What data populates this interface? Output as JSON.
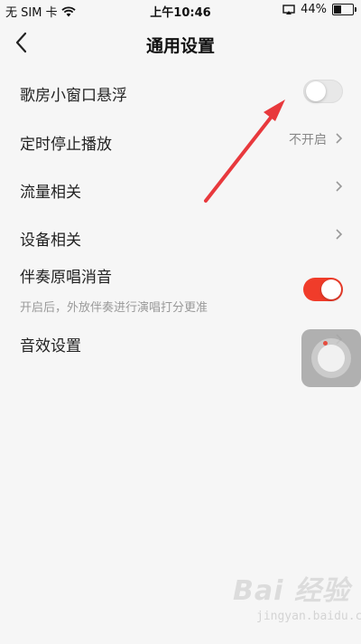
{
  "status_bar": {
    "carrier": "无 SIM 卡",
    "time": "上午10:46",
    "battery": "44%",
    "battery_level": 0.44,
    "icons": [
      "wifi-icon",
      "screen-mirror-icon",
      "battery-icon"
    ]
  },
  "nav": {
    "title": "通用设置",
    "back_icon": "chevron-left-icon"
  },
  "settings": {
    "karaoke_float": {
      "label": "歌房小窗口悬浮",
      "enabled": false
    },
    "sleep_timer": {
      "label": "定时停止播放",
      "value": "不开启"
    },
    "data_usage": {
      "label": "流量相关"
    },
    "devices": {
      "label": "设备相关"
    },
    "vocal_removal": {
      "label": "伴奏原唱消音",
      "description": "开启后，外放伴奏进行演唱打分更准",
      "enabled": true
    },
    "sound_effects": {
      "label": "音效设置"
    }
  },
  "colors": {
    "accent": "#f03c2a",
    "annotation_arrow": "#e8393d",
    "background": "#f6f6f6"
  },
  "watermark": {
    "logo": "Bai 经验",
    "url": "jingyan.baidu.com"
  }
}
